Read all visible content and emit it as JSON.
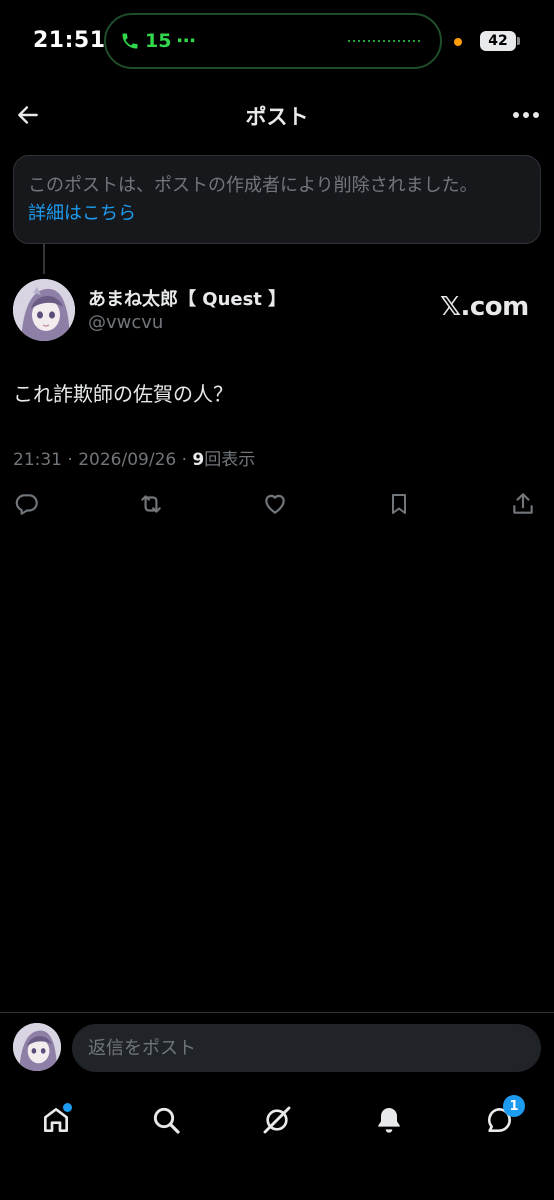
{
  "status_bar": {
    "time": "21:51",
    "call_label": "15",
    "call_dots": "⋯",
    "battery": "42"
  },
  "header": {
    "title": "ポスト"
  },
  "deleted_notice": {
    "text": "このポストは、ポストの作成者により削除されました。",
    "link": "詳細はこちら"
  },
  "post": {
    "author_name": "あまね太郎【 Quest 】",
    "author_handle": "@vwcvu",
    "source": "𝕏.com",
    "text": "これ詐欺師の佐賀の人？",
    "time": "21:31",
    "date": "2026/09/26",
    "view_count": "9",
    "view_label": "回表示"
  },
  "actions": [
    "reply-icon",
    "repost-icon",
    "like-icon",
    "bookmark-icon",
    "share-icon"
  ],
  "reply_bar": {
    "placeholder": "返信をポスト"
  },
  "nav": {
    "items": [
      "home-icon",
      "search-icon",
      "grok-icon",
      "notifications-icon",
      "messages-icon"
    ],
    "messages_badge": "1"
  },
  "colors": {
    "background": "#000000",
    "accent": "#1d9bf0",
    "secondary_text": "#71767b",
    "call_green": "#32d74b"
  }
}
